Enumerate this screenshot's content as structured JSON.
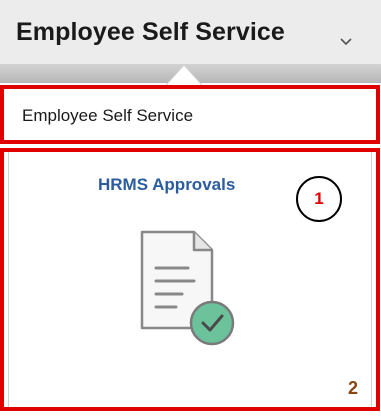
{
  "header": {
    "title": "Employee Self Service",
    "dropdown_icon": "chevron-down-icon"
  },
  "menu": {
    "items": [
      {
        "label": "Employee Self Service"
      }
    ]
  },
  "tile": {
    "title": "HRMS Approvals",
    "icon": "document-approval-icon",
    "accent_color": "#2b5d9e",
    "check_color": "#5bb98b"
  },
  "annotations": {
    "highlight_color": "#e00000",
    "callout_1": "1",
    "callout_2": "2"
  }
}
